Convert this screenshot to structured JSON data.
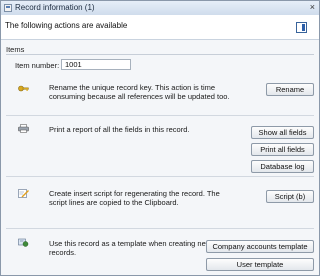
{
  "window": {
    "title": "Record information (1)",
    "close_glyph": "×"
  },
  "header": {
    "text": "The following actions are available",
    "icon": "panel-toggle-icon"
  },
  "items": {
    "group_label": "Items",
    "item_number_label": "Item number:",
    "item_number_value": "1001"
  },
  "sections": [
    {
      "icon": "key-icon",
      "description": "Rename the unique record key. This action is time consuming because all references will be updated too.",
      "buttons": [
        "Rename"
      ]
    },
    {
      "icon": "printer-icon",
      "description": "Print a report of all the fields in this record.",
      "buttons": [
        "Show all fields",
        "Print all fields",
        "Database log"
      ]
    },
    {
      "icon": "script-pencil-icon",
      "description": "Create insert script for regenerating the record. The script lines are copied to the Clipboard.",
      "buttons": [
        "Script (b)"
      ]
    },
    {
      "icon": "template-icon",
      "description": "Use this record as a template when creating new records.",
      "buttons": [
        "Company accounts template",
        "User template"
      ]
    }
  ],
  "colors": {
    "accent": "#2d5fa8",
    "button_border": "#8e9aa8"
  }
}
